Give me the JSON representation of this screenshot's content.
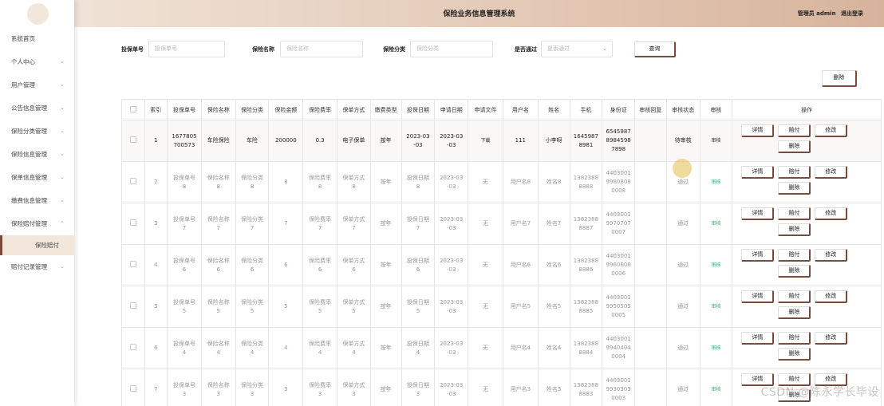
{
  "header": {
    "title": "保险业务信息管理系统",
    "user_label": "管理员 admin",
    "logout": "退出登录"
  },
  "sidebar": {
    "items": [
      {
        "label": "系统首页",
        "chevron": ""
      },
      {
        "label": "个人中心",
        "chevron": "⌄"
      },
      {
        "label": "用户管理",
        "chevron": "⌄"
      },
      {
        "label": "公告信息管理",
        "chevron": "⌄"
      },
      {
        "label": "保险分类管理",
        "chevron": "⌄"
      },
      {
        "label": "保险信息管理",
        "chevron": "⌄"
      },
      {
        "label": "保单信息管理",
        "chevron": "⌄"
      },
      {
        "label": "缴费信息管理",
        "chevron": "⌄"
      },
      {
        "label": "保险赔付管理",
        "chevron": "⌃"
      }
    ],
    "sub_item": "保险赔付",
    "last_item": {
      "label": "赔付记录管理",
      "chevron": "⌄"
    }
  },
  "search": {
    "policy_no_label": "投保单号",
    "policy_no_placeholder": "投保单号",
    "name_label": "保险名称",
    "name_placeholder": "保险名称",
    "category_label": "保险分类",
    "category_placeholder": "保险分类",
    "approved_label": "是否通过",
    "approved_placeholder": "是否通过",
    "query_button": "查询"
  },
  "toolbar": {
    "delete_button": "删除"
  },
  "table": {
    "headers": [
      "索引",
      "投保单号",
      "保险名称",
      "保险分类",
      "保险金额",
      "保险费率",
      "保单方式",
      "缴费类型",
      "投保日期",
      "申请日期",
      "申请文件",
      "用户名",
      "姓名",
      "手机",
      "身份证",
      "审核回复",
      "审核状态",
      "审核",
      "操作"
    ],
    "rows": [
      {
        "idx": "1",
        "policy_no": "1677805\n700573",
        "name": "车险保险",
        "category": "车险",
        "amount": "200000",
        "rate": "0.3",
        "method": "电子保单",
        "pay_type": "按年",
        "date": "2023-03\n-03",
        "apply_date": "2023-03\n-03",
        "file": "下载",
        "username": "111",
        "realname": "小李呀",
        "phone": "1645987\n8981",
        "id_card": "6545987\n8984598\n7898",
        "reply": "",
        "status": "待审核",
        "audit": "审核"
      },
      {
        "idx": "2",
        "policy_no": "投保单号\n8",
        "name": "保险名称\n8",
        "category": "保险分类\n8",
        "amount": "8",
        "rate": "保险费率\n8",
        "method": "保单方式\n8",
        "pay_type": "按年",
        "date": "投保日期\n8",
        "apply_date": "2023-03\n-03",
        "file": "无",
        "username": "用户名8",
        "realname": "姓名8",
        "phone": "1382388\n8888",
        "id_card": "4403001\n9980808\n0008",
        "reply": "",
        "status": "通过",
        "audit": "审核"
      },
      {
        "idx": "3",
        "policy_no": "投保单号\n7",
        "name": "保险名称\n7",
        "category": "保险分类\n7",
        "amount": "7",
        "rate": "保险费率\n7",
        "method": "保单方式\n7",
        "pay_type": "按年",
        "date": "投保日期\n7",
        "apply_date": "2023-03\n-03",
        "file": "无",
        "username": "用户名7",
        "realname": "姓名7",
        "phone": "1382388\n8887",
        "id_card": "4403001\n9970707\n0007",
        "reply": "",
        "status": "通过",
        "audit": "审核"
      },
      {
        "idx": "4",
        "policy_no": "投保单号\n6",
        "name": "保险名称\n6",
        "category": "保险分类\n6",
        "amount": "6",
        "rate": "保险费率\n6",
        "method": "保单方式\n6",
        "pay_type": "按年",
        "date": "投保日期\n6",
        "apply_date": "2023-03\n-03",
        "file": "无",
        "username": "用户名6",
        "realname": "姓名6",
        "phone": "1382388\n8886",
        "id_card": "4403001\n9960606\n0006",
        "reply": "",
        "status": "通过",
        "audit": "审核"
      },
      {
        "idx": "5",
        "policy_no": "投保单号\n5",
        "name": "保险名称\n5",
        "category": "保险分类\n5",
        "amount": "5",
        "rate": "保险费率\n5",
        "method": "保单方式\n5",
        "pay_type": "按年",
        "date": "投保日期\n5",
        "apply_date": "2023-03\n-03",
        "file": "无",
        "username": "用户名5",
        "realname": "姓名5",
        "phone": "1382388\n8885",
        "id_card": "4403001\n9950505\n0005",
        "reply": "",
        "status": "通过",
        "audit": "审核"
      },
      {
        "idx": "6",
        "policy_no": "投保单号\n4",
        "name": "保险名称\n4",
        "category": "保险分类\n4",
        "amount": "4",
        "rate": "保险费率\n4",
        "method": "保单方式\n4",
        "pay_type": "按年",
        "date": "投保日期\n4",
        "apply_date": "2023-03\n-03",
        "file": "无",
        "username": "用户名4",
        "realname": "姓名4",
        "phone": "1382388\n8884",
        "id_card": "4403001\n9940404\n0004",
        "reply": "",
        "status": "通过",
        "audit": "审核"
      },
      {
        "idx": "7",
        "policy_no": "投保单号\n3",
        "name": "保险名称\n3",
        "category": "保险分类\n3",
        "amount": "3",
        "rate": "保险费率\n3",
        "method": "保单方式\n3",
        "pay_type": "按年",
        "date": "投保日期\n3",
        "apply_date": "2023-03\n-03",
        "file": "无",
        "username": "用户名3",
        "realname": "姓名3",
        "phone": "1382388\n8883",
        "id_card": "4403001\n9930303\n0003",
        "reply": "",
        "status": "通过",
        "audit": "审核"
      }
    ],
    "op_labels": {
      "detail": "详情",
      "pay": "赔付",
      "edit": "修改",
      "delete": "删除"
    }
  },
  "watermark": "CSDN @陈永学长毕设",
  "colors": {
    "accent": "#7a4a3e",
    "header_start": "#efe2d6",
    "header_end": "#d7b39c",
    "link": "#3aa86b"
  }
}
